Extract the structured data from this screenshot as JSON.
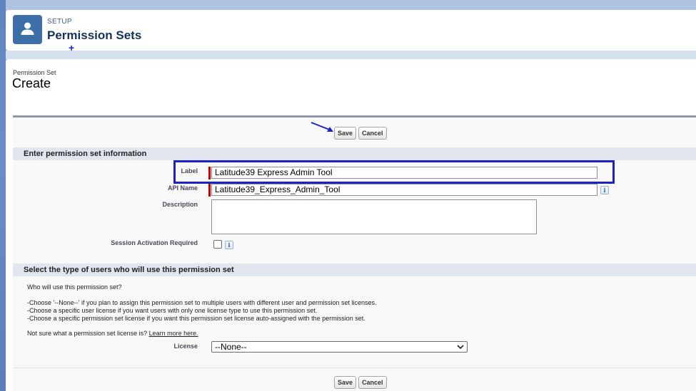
{
  "header": {
    "eyebrow": "SETUP",
    "title": "Permission Sets",
    "icon": "user-icon"
  },
  "page": {
    "eyebrow": "Permission Set",
    "title": "Create"
  },
  "toolbar": {
    "save_label": "Save",
    "cancel_label": "Cancel"
  },
  "section1": {
    "title": "Enter permission set information",
    "fields": {
      "label": {
        "label": "Label",
        "value": "Latitude39 Express Admin Tool"
      },
      "api_name": {
        "label": "API Name",
        "value": "Latitude39_Express_Admin_Tool"
      },
      "description": {
        "label": "Description",
        "value": ""
      },
      "session_activation": {
        "label": "Session Activation Required",
        "checked": false
      }
    }
  },
  "section2": {
    "title": "Select the type of users who will use this permission set",
    "question": "Who will use this permission set?",
    "instructions": [
      "-Choose '--None--' if you plan to assign this permission set to multiple users with different user and permission set licenses.",
      "-Choose a specific user license if you want users with only one license type to use this permission set.",
      "-Choose a specific permission set license if you want this permission set license auto-assigned with the permission set."
    ],
    "not_sure_text": "Not sure what a permission set license is?",
    "learn_more": "Learn more here.",
    "license_label": "License",
    "license_value": "--None--"
  },
  "colors": {
    "highlight": "#1a22c8",
    "required": "#cc0000",
    "header_icon_bg": "#3c6fa8"
  }
}
